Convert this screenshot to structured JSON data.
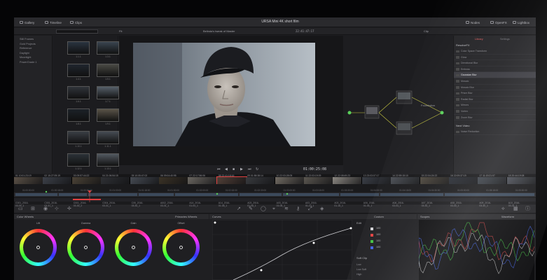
{
  "topbar": {
    "gallery": "Gallery",
    "timeline": "Timeline",
    "clips": "Clips",
    "project_title": "URSA Mini 4K short film",
    "nodes": "Nodes",
    "openfx": "OpenFX",
    "lightbox": "Lightbox"
  },
  "toolbar2": {
    "fit": "Fit",
    "viewer_title": "Belinda's tweak of Master",
    "timecode": "22:41:47:17",
    "clip": "Clip"
  },
  "left_panel": [
    "Still Frames",
    "Gold Projects",
    "Reference",
    "Daylight",
    "Moonlight",
    "PowerGrade 1"
  ],
  "gallery": {
    "labels": [
      "1.1.1",
      "1.3.1",
      "1.4.1",
      "1.5.1",
      "1.6.1",
      "1.7.1",
      "1.8.1",
      "1.9.1",
      "1.10.1",
      "1.11.1",
      "1.12.1",
      "1.13.1"
    ]
  },
  "viewer": {
    "timecode": "01:00:25:08"
  },
  "nodes": {
    "node_label": "Foundation"
  },
  "library": {
    "tab_library": "Library",
    "tab_settings": "Settings",
    "section_resolve": "ResolveFX",
    "items": [
      "Color Space Transform",
      "Glow",
      "Directional Blur",
      "Emboss",
      "Gaussian Blur",
      "Mosaic",
      "Mosaic Blur",
      "Prism Blur",
      "Radial Blur",
      "Mirrors",
      "Vortex",
      "Zoom Blur"
    ],
    "selected_index": 4,
    "section_next": "Next Video",
    "next_item": "Noise Reduction"
  },
  "clips": [
    {
      "num": "01",
      "tc": "10:01:23:19",
      "name": "C001_2016-03-30_1"
    },
    {
      "num": "02",
      "tc": "15:27:09:19",
      "name": "C001_2016-03-31_1"
    },
    {
      "num": "03",
      "tc": "09:57:44:22",
      "name": "C001_2016-03-30_2"
    },
    {
      "num": "04",
      "tc": "21:06:54:15",
      "name": "C004_2016-03-31_1"
    },
    {
      "num": "05",
      "tc": "10:05:47:02",
      "name": "C05_2016-03-30_1"
    },
    {
      "num": "06",
      "tc": "09:04:40:95",
      "name": "A002_2016-03-31_1"
    },
    {
      "num": "07",
      "tc": "22:17:56:06",
      "name": "A14_2016-01-04_1"
    },
    {
      "num": "08",
      "tc": "22:41:18:16",
      "name": "A14_2016-01-08_1"
    },
    {
      "num": "09",
      "tc": "01:58:38:14",
      "name": "A03_2016-01-08_1"
    },
    {
      "num": "10",
      "tc": "22:03:28:05",
      "name": "A03_2016-01-08_1"
    },
    {
      "num": "11",
      "tc": "22:03:19:09",
      "name": "A03_2016-01-10_1"
    },
    {
      "num": "12",
      "tc": "22:08:49:23",
      "name": "A03_2016-01-18_1"
    },
    {
      "num": "13",
      "tc": "23:03:07:17",
      "name": "A06_2016-01-06_1"
    },
    {
      "num": "14",
      "tc": "22:59:15:10",
      "name": "A06_2016-03-04_1"
    },
    {
      "num": "15",
      "tc": "22:04:24:22",
      "name": "A07_2016-03-30_1"
    },
    {
      "num": "16",
      "tc": "22:09:37:19",
      "name": "A08_2016-03-30_1"
    },
    {
      "num": "17",
      "tc": "11:19:21:07",
      "name": "A09_2016-03-30_1"
    },
    {
      "num": "18",
      "tc": "20:44:19:08",
      "name": "A10_2016-03-31_1"
    }
  ],
  "timeline_marks": [
    "01:00:00:00",
    "01:00:18:00",
    "01:00:30:00",
    "01:01:00:00",
    "01:01:18:00",
    "01:01:30:00",
    "01:02:00:00",
    "01:02:18:00",
    "01:02:30:00",
    "01:03:00:00",
    "01:03:18:00",
    "01:03:30:00",
    "01:04:00:00",
    "01:04:18:00",
    "01:04:30:00",
    "01:05:00:00",
    "01:05:18:00",
    "01:05:30:00"
  ],
  "color_wheels": {
    "title": "Color Wheels",
    "mode": "Primaries Wheels",
    "wheels": [
      "Lift",
      "Gamma",
      "Gain",
      "Offset"
    ]
  },
  "curves": {
    "title": "Curves",
    "mode": "Custom",
    "edit_label": "Edit",
    "values": [
      "100",
      "100",
      "100",
      "100"
    ],
    "soft_clip": "Soft Clip",
    "low": "Low",
    "low_soft": "Low Soft",
    "high": "High"
  },
  "scopes": {
    "title": "Scopes",
    "mode": "Waveform"
  },
  "colors": {
    "accent_red": "#e04040",
    "accent_orange": "#f08a20",
    "selection": "#3a3a40"
  }
}
